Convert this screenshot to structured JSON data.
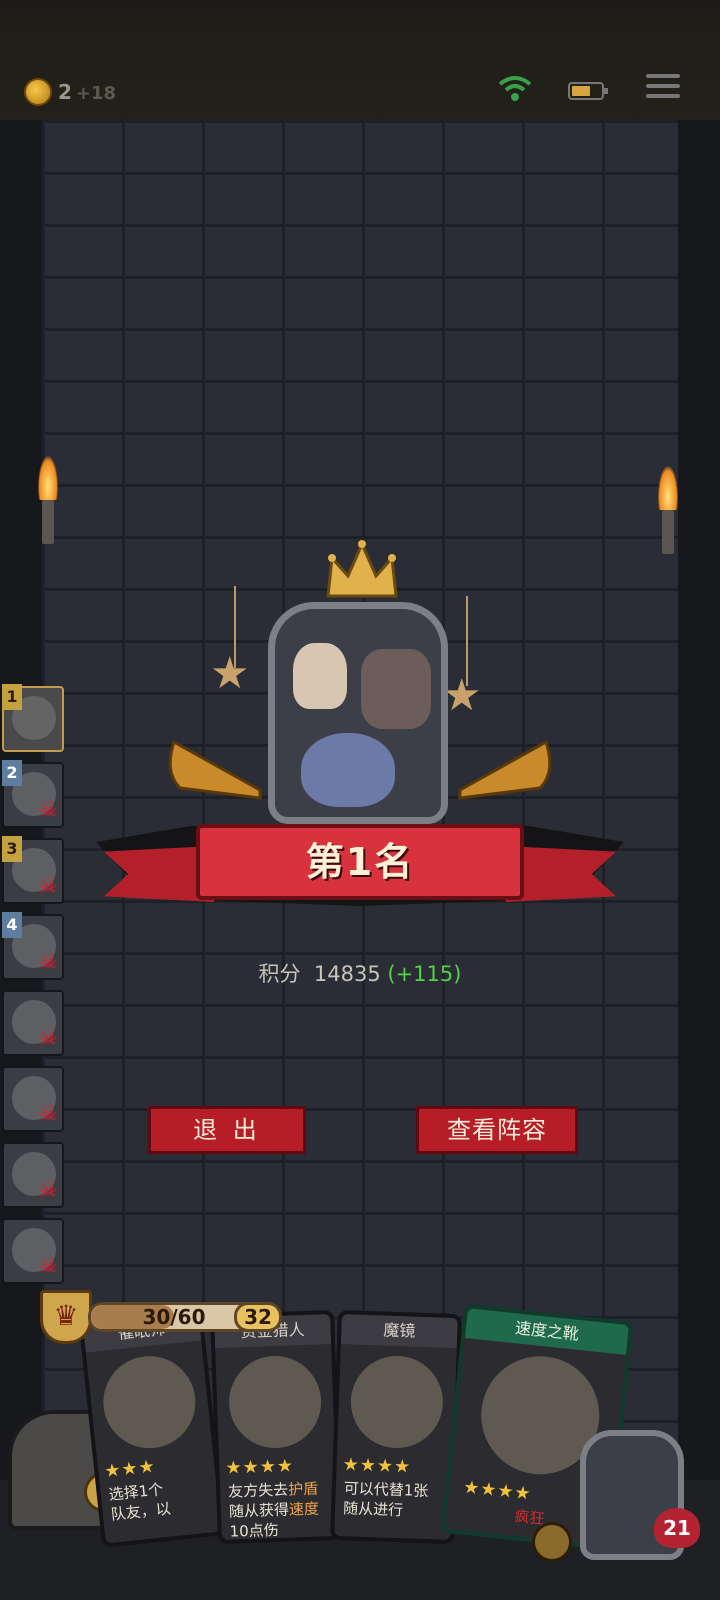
{
  "topbar": {
    "coins": "2",
    "coin_bonus": "+18"
  },
  "leaderboard": [
    {
      "rank": "1",
      "eliminated": false,
      "rank_color": "gold"
    },
    {
      "rank": "2",
      "eliminated": true,
      "rank_color": "blue"
    },
    {
      "rank": "3",
      "eliminated": true,
      "rank_color": "gold"
    },
    {
      "rank": "4",
      "eliminated": true,
      "rank_color": "blue"
    },
    {
      "rank": "",
      "eliminated": true
    },
    {
      "rank": "",
      "eliminated": true
    },
    {
      "rank": "",
      "eliminated": true
    },
    {
      "rank": "",
      "eliminated": true
    }
  ],
  "result": {
    "placement": "第1名",
    "score_label": "积分",
    "score": "14835",
    "score_delta": "(+115)"
  },
  "buttons": {
    "exit": "退 出",
    "view_lineup": "查看阵容"
  },
  "hud": {
    "level_icon": "crown-icon",
    "xp_text": "30/60",
    "xp_fraction": 0.5,
    "gold": "32",
    "chest_coins": "0",
    "health": "21"
  },
  "hand": [
    {
      "title": "催眠师",
      "stars": "★★★",
      "desc": "选择1个\n队友，以",
      "style": "normal"
    },
    {
      "title": "赏金猎人",
      "stars": "★★★★",
      "desc_parts": [
        "友方失去",
        "护盾",
        "\n随从获得",
        "速度",
        "\n10点伤"
      ],
      "style": "normal"
    },
    {
      "title": "魔镜",
      "stars": "★★★★",
      "desc": "可以代替1张\n随从进行",
      "style": "normal"
    },
    {
      "title": "速度之靴",
      "stars": "★★★★",
      "desc": "疯狂",
      "style": "green"
    }
  ]
}
